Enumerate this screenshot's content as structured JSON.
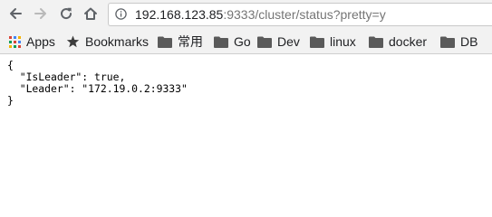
{
  "toolbar": {
    "back_icon": "arrow-left-icon",
    "forward_icon": "arrow-right-icon",
    "reload_icon": "reload-icon",
    "home_icon": "home-icon"
  },
  "address_bar": {
    "info_icon": "info-icon",
    "host": "192.168.123.85",
    "rest": ":9333/cluster/status?pretty=y"
  },
  "bookmarks": {
    "apps_label": "Apps",
    "bookmarks_label": "Bookmarks",
    "folders": [
      "常用",
      "Go",
      "Dev",
      "linux",
      "docker",
      "DB"
    ]
  },
  "content": {
    "lines": [
      "{",
      "  \"IsLeader\": true,",
      "  \"Leader\": \"172.19.0.2:9333\"",
      "}"
    ]
  }
}
